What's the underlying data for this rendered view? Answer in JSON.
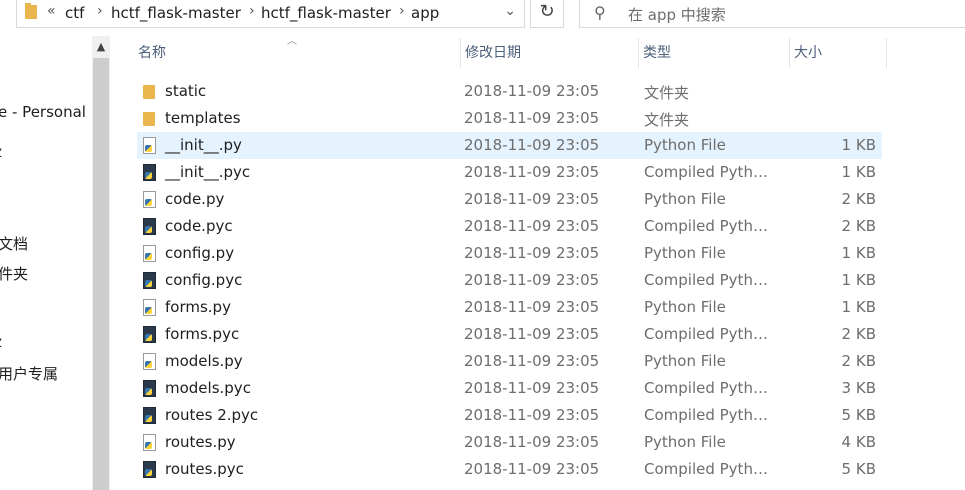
{
  "address_bar": {
    "overflow_chevron": "«",
    "crumbs": [
      "ctf",
      "hctf_flask-master",
      "hctf_flask-master",
      "app"
    ],
    "separator": "›",
    "dropdown": "⌄"
  },
  "refresh_glyph": "↻",
  "search": {
    "icon": "search-icon",
    "placeholder": "在 app 中搜索"
  },
  "nav": {
    "items": [
      "e - Personal",
      "z",
      "文档",
      "件夹",
      "z",
      "用户专属"
    ]
  },
  "columns": {
    "name": "名称",
    "date": "修改日期",
    "type": "类型",
    "size": "大小"
  },
  "files": [
    {
      "name": "static",
      "date": "2018-11-09 23:05",
      "type": "文件夹",
      "size": "",
      "icon": "folder-icon"
    },
    {
      "name": "templates",
      "date": "2018-11-09 23:05",
      "type": "文件夹",
      "size": "",
      "icon": "folder-icon"
    },
    {
      "name": "__init__.py",
      "date": "2018-11-09 23:05",
      "type": "Python File",
      "size": "1 KB",
      "icon": "python-file-icon",
      "selected": true
    },
    {
      "name": "__init__.pyc",
      "date": "2018-11-09 23:05",
      "type": "Compiled Pytho...",
      "size": "1 KB",
      "icon": "compiled-python-icon"
    },
    {
      "name": "code.py",
      "date": "2018-11-09 23:05",
      "type": "Python File",
      "size": "2 KB",
      "icon": "python-file-icon"
    },
    {
      "name": "code.pyc",
      "date": "2018-11-09 23:05",
      "type": "Compiled Pytho...",
      "size": "2 KB",
      "icon": "compiled-python-icon"
    },
    {
      "name": "config.py",
      "date": "2018-11-09 23:05",
      "type": "Python File",
      "size": "1 KB",
      "icon": "python-file-icon"
    },
    {
      "name": "config.pyc",
      "date": "2018-11-09 23:05",
      "type": "Compiled Pytho...",
      "size": "1 KB",
      "icon": "compiled-python-icon"
    },
    {
      "name": "forms.py",
      "date": "2018-11-09 23:05",
      "type": "Python File",
      "size": "1 KB",
      "icon": "python-file-icon"
    },
    {
      "name": "forms.pyc",
      "date": "2018-11-09 23:05",
      "type": "Compiled Pytho...",
      "size": "2 KB",
      "icon": "compiled-python-icon"
    },
    {
      "name": "models.py",
      "date": "2018-11-09 23:05",
      "type": "Python File",
      "size": "2 KB",
      "icon": "python-file-icon"
    },
    {
      "name": "models.pyc",
      "date": "2018-11-09 23:05",
      "type": "Compiled Pytho...",
      "size": "3 KB",
      "icon": "compiled-python-icon"
    },
    {
      "name": "routes 2.pyc",
      "date": "2018-11-09 23:05",
      "type": "Compiled Pytho...",
      "size": "5 KB",
      "icon": "compiled-python-icon"
    },
    {
      "name": "routes.py",
      "date": "2018-11-09 23:05",
      "type": "Python File",
      "size": "4 KB",
      "icon": "python-file-icon"
    },
    {
      "name": "routes.pyc",
      "date": "2018-11-09 23:05",
      "type": "Compiled Pytho...",
      "size": "5 KB",
      "icon": "compiled-python-icon"
    }
  ]
}
